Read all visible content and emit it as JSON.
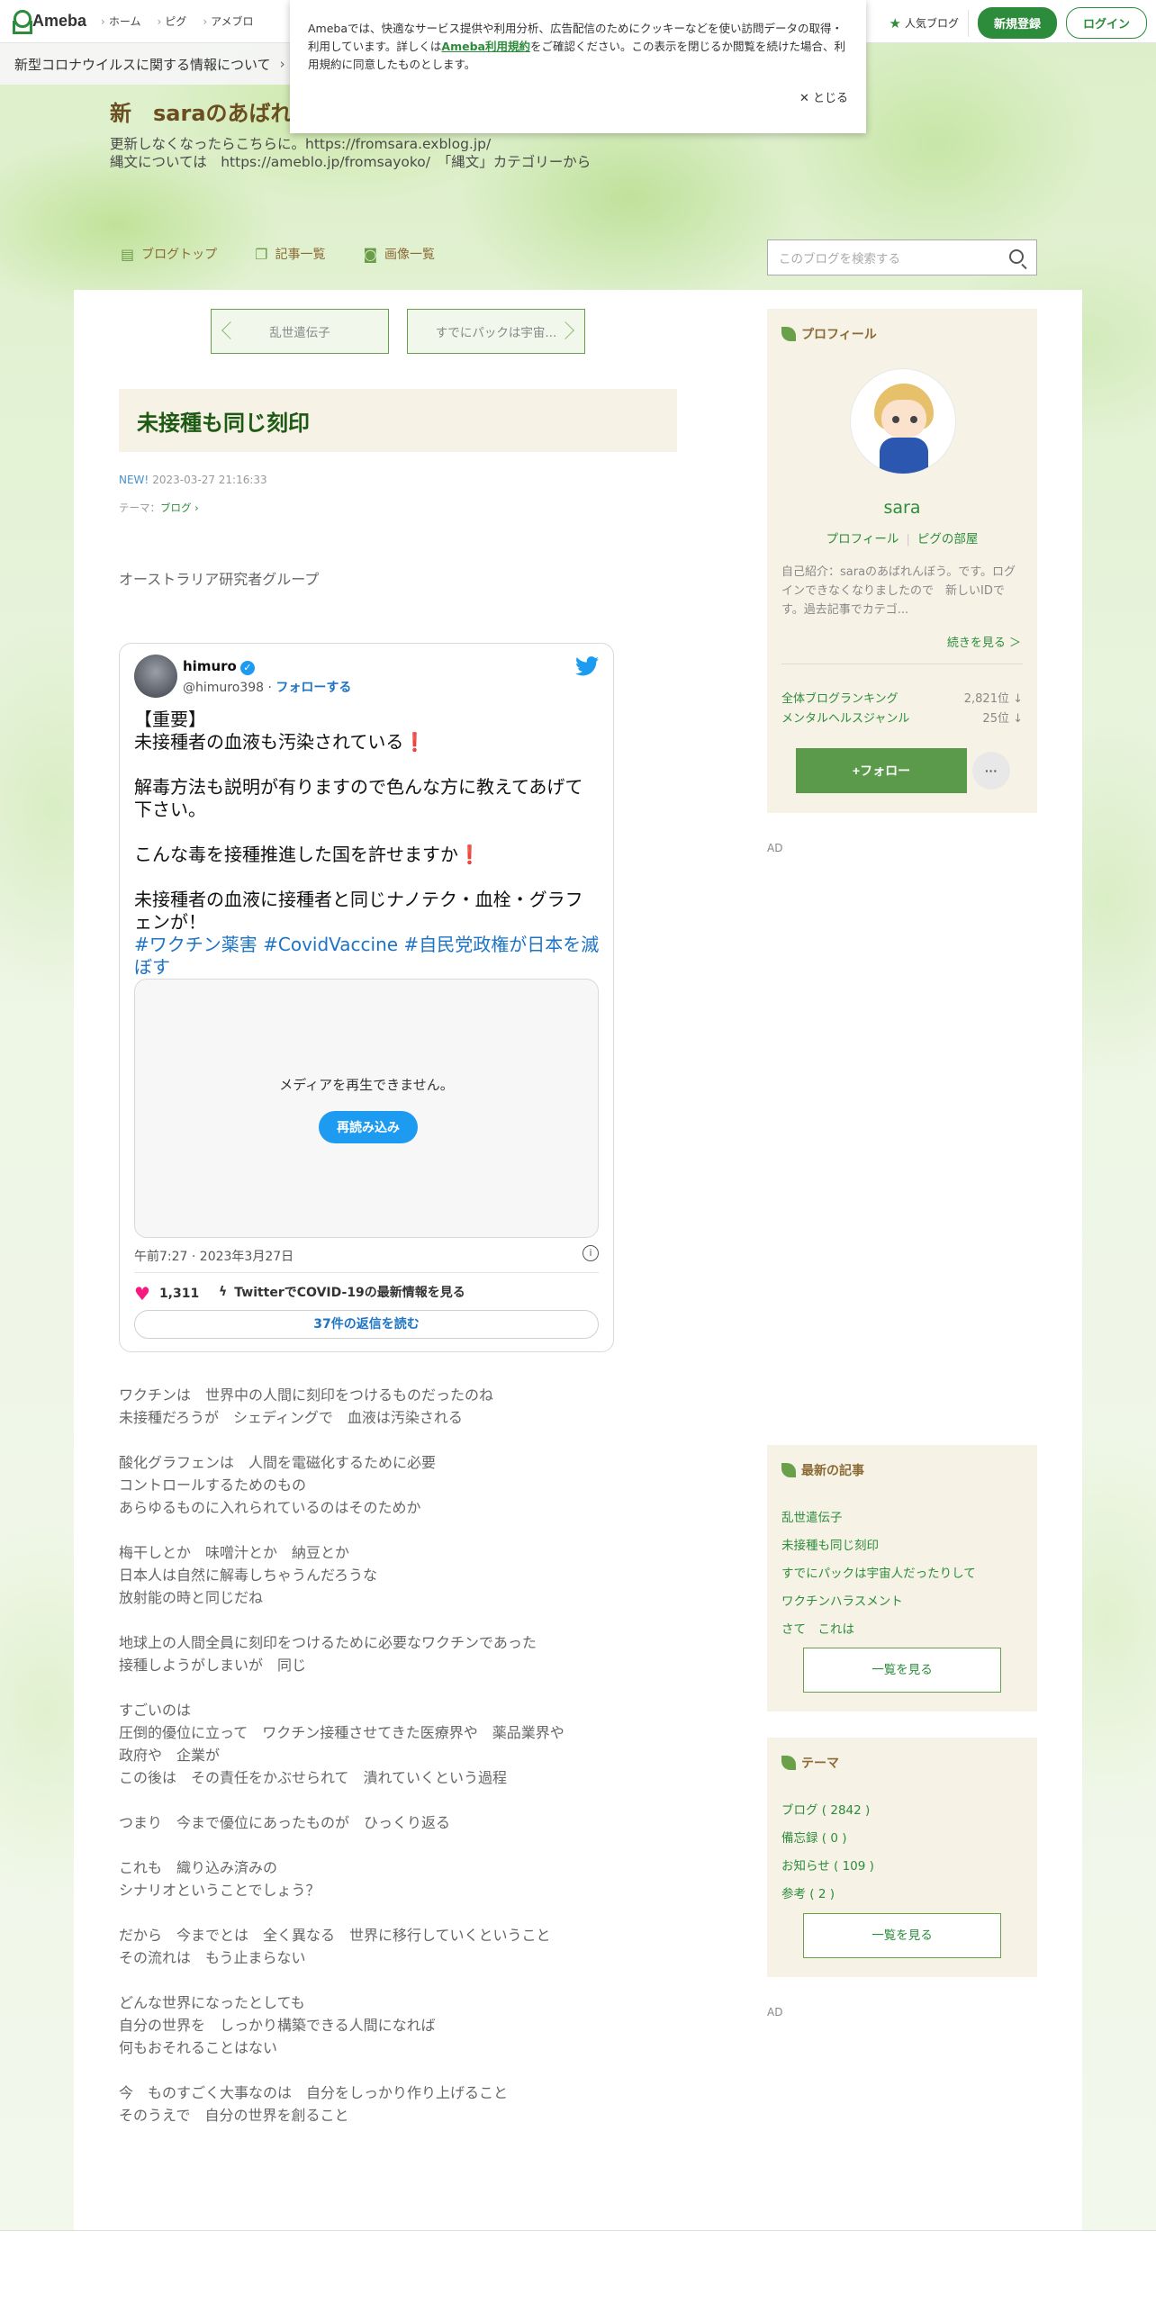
{
  "topnav": {
    "logo": "Ameba",
    "links": [
      "ホーム",
      "ピグ",
      "アメブロ"
    ],
    "popular_blog": "人気ブログ",
    "register": "新規登録",
    "login": "ログイン"
  },
  "covid_bar": {
    "text": "新型コロナウイルスに関する情報について"
  },
  "cookie": {
    "text_before": "Amebaでは、快適なサービス提供や利用分析、広告配信のためにクッキーなどを使い訪問データの取得・利用しています。詳しくは",
    "link": "Ameba利用規約",
    "text_after": "をご確認ください。この表示を閉じるか閲覧を続けた場合、利用規約に同意したものとします。",
    "close": "とじる"
  },
  "header": {
    "title": "新　saraのあばれ",
    "desc_line1": "更新しなくなったらこちらに。https://fromsara.exblog.jp/",
    "desc_line2": "縄文については　https://ameblo.jp/fromsayoko/　「縄文」カテゴリーから",
    "nav": [
      "ブログトップ",
      "記事一覧",
      "画像一覧"
    ],
    "search_placeholder": "このブログを検索する"
  },
  "pager": {
    "prev": "乱世遣伝子",
    "next": "すでにパックは宇宙..."
  },
  "entry": {
    "title": "未接種も同じ刻印",
    "new_label": "NEW!",
    "datetime": "2023-03-27 21:16:33",
    "theme_label": "テーマ：",
    "theme": "ブログ",
    "lead": "オーストラリア研究者グループ",
    "body": [
      "ワクチンは　世界中の人間に刻印をつけるものだったのね\n未接種だろうが　シェディングで　血液は汚染される",
      "酸化グラフェンは　人間を電磁化するために必要\nコントロールするためのもの\nあらゆるものに入れられているのはそのためか",
      "梅干しとか　味噌汁とか　納豆とか\n日本人は自然に解毒しちゃうんだろうな\n放射能の時と同じだね",
      "地球上の人間全員に刻印をつけるために必要なワクチンであった\n接種しようがしまいが　同じ",
      "すごいのは\n圧倒的優位に立って　ワクチン接種させてきた医療界や　薬品業界や\n政府や　企業が\nこの後は　その責任をかぶせられて　潰れていくという過程",
      "つまり　今まで優位にあったものが　ひっくり返る",
      "これも　織り込み済みの\nシナリオということでしょう？",
      "だから　今までとは　全く異なる　世界に移行していくということ\nその流れは　もう止まらない",
      "どんな世界になったとしても\n自分の世界を　しっかり構築できる人間になれば\n何もおそれることはない",
      "今　ものすごく大事なのは　自分をしっかり作り上げること\nそのうえで　自分の世界を創ること"
    ]
  },
  "tweet": {
    "name": "himuro",
    "handle": "@himuro398 · ",
    "follow": "フォローする",
    "text": "【重要】\n未接種者の血液も汚染されている❗\n\n解毒方法も説明が有りますので色んな方に教えてあげて下さい。\n\nこんな毒を接種推進した国を許せますか❗\n\n未接種者の血液に接種者と同じナノテク・血栓・グラフェンが！",
    "hashtags": "#ワクチン薬害 #CovidVaccine #自民党政権が日本を滅ぼす",
    "media_message": "メディアを再生できません。",
    "reload": "再読み込み",
    "time": "午前7:27 · 2023年3月27日",
    "likes": "1,311",
    "covid_link": "TwitterでCOVID-19の最新情報を見る",
    "replies": "37件の返信を読む"
  },
  "sidebar": {
    "profile": {
      "heading": "プロフィール",
      "name": "sara",
      "link_profile": "プロフィール",
      "link_pig": "ピグの部屋",
      "desc": "自己紹介：saraのあばれんぼう。です。ログインできなくなりましたので　新しいIDです。過去記事でカテゴ...",
      "more": "続きを見る ＞",
      "ranking_all_label": "全体ブログランキング",
      "ranking_all_value": "2,821位 ↓",
      "ranking_genre_label": "メンタルヘルスジャンル",
      "ranking_genre_value": "25位 ↓",
      "follow": "+フォロー",
      "more_btn": "···"
    },
    "ad": "AD",
    "recent": {
      "heading": "最新の記事",
      "items": [
        "乱世遣伝子",
        "未接種も同じ刻印",
        "すでにパックは宇宙人だったりして",
        "ワクチンハラスメント",
        "さて　これは"
      ],
      "all": "一覧を見る"
    },
    "themes": {
      "heading": "テーマ",
      "items": [
        "ブログ ( 2842 )",
        "備忘録 ( 0 )",
        "お知らせ ( 109 )",
        "参考 ( 2 )"
      ],
      "all": "一覧を見る"
    }
  }
}
